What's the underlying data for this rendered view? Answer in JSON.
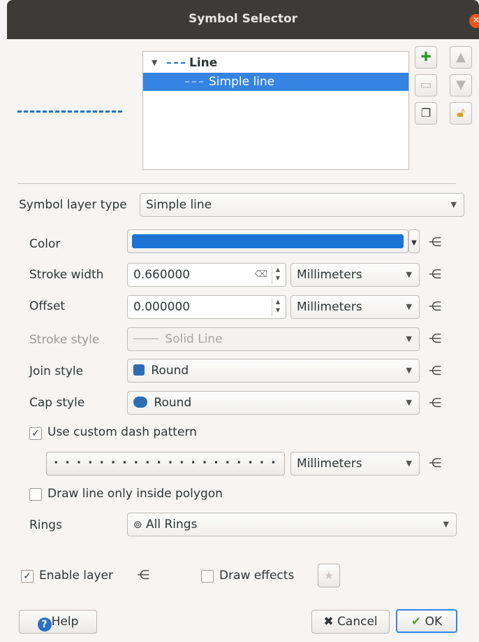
{
  "window": {
    "title": "Symbol Selector"
  },
  "tree": {
    "items": [
      {
        "label": "Line"
      },
      {
        "label": "Simple line"
      }
    ]
  },
  "symbol_layer_type": {
    "label": "Symbol layer type",
    "value": "Simple line"
  },
  "form": {
    "color": {
      "label": "Color",
      "value": "#1b74d4"
    },
    "stroke_width": {
      "label": "Stroke width",
      "value": "0.660000",
      "unit": "Millimeters"
    },
    "offset": {
      "label": "Offset",
      "value": "0.000000",
      "unit": "Millimeters"
    },
    "stroke_style": {
      "label": "Stroke style",
      "value": "Solid Line"
    },
    "join_style": {
      "label": "Join style",
      "value": "Round"
    },
    "cap_style": {
      "label": "Cap style",
      "value": "Round"
    },
    "custom_dash": {
      "label": "Use custom dash pattern",
      "checked": true,
      "unit": "Millimeters"
    },
    "draw_inside": {
      "label": "Draw line only inside polygon",
      "checked": false
    },
    "rings": {
      "label": "Rings",
      "value": "All Rings"
    }
  },
  "footer": {
    "enable_layer": {
      "label": "Enable layer",
      "checked": true
    },
    "draw_effects": {
      "label": "Draw effects",
      "checked": false
    },
    "help": "Help",
    "cancel": "Cancel",
    "ok": "OK"
  },
  "colors": {
    "accent": "#3584e4",
    "line": "#1b74d4",
    "title_bg": "#3c3b37",
    "close": "#e95420"
  }
}
